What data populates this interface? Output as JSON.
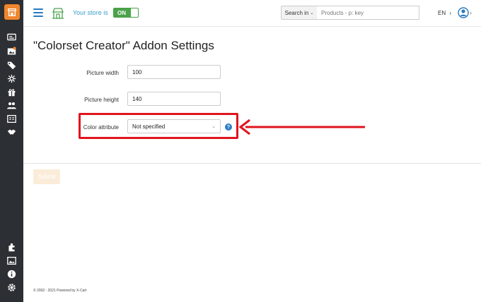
{
  "header": {
    "store_label": "Your store is",
    "store_toggle": "ON",
    "search_button": "Search in",
    "search_placeholder": "Products - p: key",
    "language": "EN"
  },
  "page": {
    "title": "\"Colorset Creator\" Addon Settings"
  },
  "form": {
    "picture_width_label": "Picture width",
    "picture_width_value": "100",
    "picture_height_label": "Picture height",
    "picture_height_value": "140",
    "color_attribute_label": "Color attribute",
    "color_attribute_value": "Not specified",
    "submit_label": "Submit"
  },
  "footer": {
    "text": "© 2002 - 2021 Powered by X-Cart"
  },
  "colors": {
    "sidebar": "#2c2f33",
    "brand": "#f0862d",
    "accent": "#2b7bc0",
    "toggle_on": "#4aa24a",
    "highlight": "#e0141e"
  },
  "icons": {
    "sidebar_top": [
      "orders-icon",
      "catalog-icon",
      "tags-icon",
      "discounts-icon",
      "gift-icon",
      "users-icon",
      "content-icon",
      "handshake-icon"
    ],
    "sidebar_bottom": [
      "addons-icon",
      "image-icon",
      "info-icon",
      "settings-icon"
    ]
  }
}
